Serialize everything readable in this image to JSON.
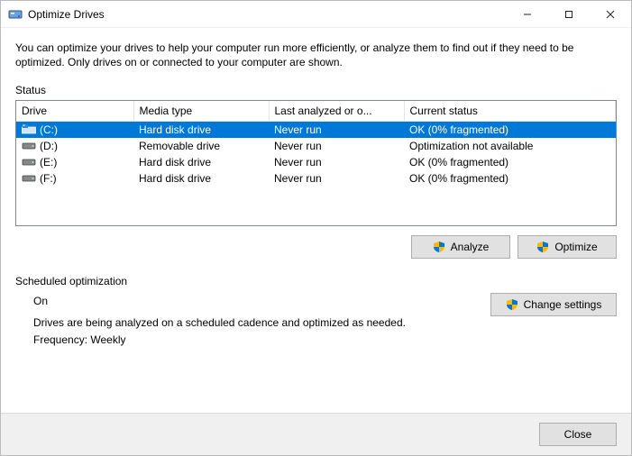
{
  "window": {
    "title": "Optimize Drives"
  },
  "description": "You can optimize your drives to help your computer run more efficiently, or analyze them to find out if they need to be optimized. Only drives on or connected to your computer are shown.",
  "status_label": "Status",
  "columns": {
    "drive": "Drive",
    "media": "Media type",
    "last": "Last analyzed or o...",
    "current": "Current status"
  },
  "drives": [
    {
      "name": "(C:)",
      "media": "Hard disk drive",
      "last": "Never run",
      "status": "OK (0% fragmented)",
      "selected": true,
      "icon": "windows-drive"
    },
    {
      "name": "(D:)",
      "media": "Removable drive",
      "last": "Never run",
      "status": "Optimization not available",
      "selected": false,
      "icon": "hdd"
    },
    {
      "name": "(E:)",
      "media": "Hard disk drive",
      "last": "Never run",
      "status": "OK (0% fragmented)",
      "selected": false,
      "icon": "hdd"
    },
    {
      "name": "(F:)",
      "media": "Hard disk drive",
      "last": "Never run",
      "status": "OK (0% fragmented)",
      "selected": false,
      "icon": "hdd"
    }
  ],
  "buttons": {
    "analyze": "Analyze",
    "optimize": "Optimize",
    "change_settings": "Change settings",
    "close": "Close"
  },
  "schedule": {
    "label": "Scheduled optimization",
    "state": "On",
    "desc": "Drives are being analyzed on a scheduled cadence and optimized as needed.",
    "frequency": "Frequency: Weekly"
  }
}
